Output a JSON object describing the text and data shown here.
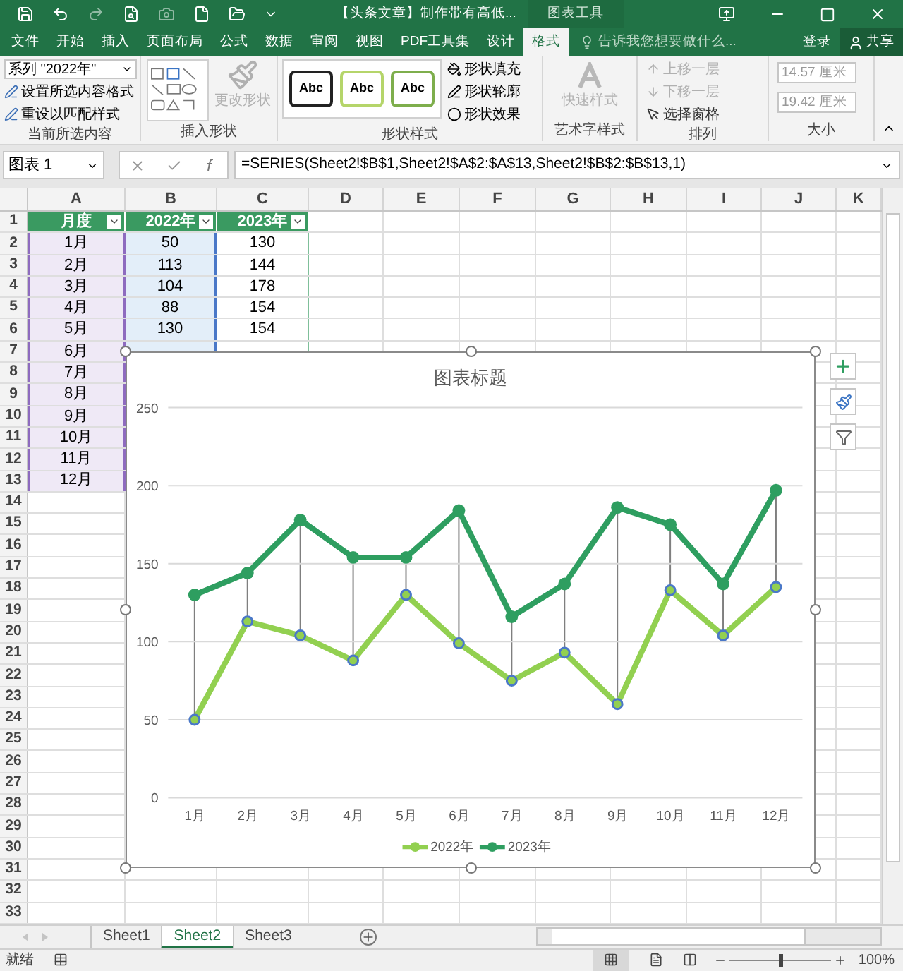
{
  "window": {
    "title": "【头条文章】制作带有高低...",
    "context_tab": "图表工具"
  },
  "ribbon_tabs": [
    {
      "label": "文件",
      "selected": false
    },
    {
      "label": "开始",
      "selected": false
    },
    {
      "label": "插入",
      "selected": false
    },
    {
      "label": "页面布局",
      "selected": false
    },
    {
      "label": "公式",
      "selected": false
    },
    {
      "label": "数据",
      "selected": false
    },
    {
      "label": "审阅",
      "selected": false
    },
    {
      "label": "视图",
      "selected": false
    },
    {
      "label": "PDF工具集",
      "selected": false
    },
    {
      "label": "设计",
      "selected": false
    },
    {
      "label": "格式",
      "selected": true
    }
  ],
  "tell_me": {
    "placeholder": "告诉我您想要做什么..."
  },
  "sign_in": "登录",
  "share": "共享",
  "ribbon": {
    "groups": [
      {
        "kind": "selection",
        "label": "当前所选内容",
        "dropdown": "系列 \"2022年\"",
        "buttons": [
          "设置所选内容格式",
          "重设以匹配样式"
        ]
      },
      {
        "kind": "shapes",
        "label": "插入形状",
        "button": {
          "label": "更改形状",
          "disabled": true
        }
      },
      {
        "kind": "styles",
        "label": "形状样式",
        "samples": [
          "Abc",
          "Abc",
          "Abc"
        ],
        "buttons": [
          "形状填充",
          "形状轮廓",
          "形状效果"
        ]
      },
      {
        "kind": "wordart",
        "label": "艺术字样式",
        "button": {
          "label": "快速样式",
          "disabled": true
        }
      },
      {
        "kind": "arrange",
        "label": "排列",
        "buttons": [
          {
            "label": "上移一层",
            "disabled": true
          },
          {
            "label": "下移一层",
            "disabled": true
          },
          {
            "label": "选择窗格",
            "disabled": false
          }
        ]
      },
      {
        "kind": "size",
        "label": "大小",
        "fields": [
          "14.57 厘米",
          "19.42 厘米"
        ]
      }
    ]
  },
  "name_box": "图表 1",
  "formula": "=SERIES(Sheet2!$B$1,Sheet2!$A$2:$A$13,Sheet2!$B$2:$B$13,1)",
  "columns": [
    "A",
    "B",
    "C",
    "D",
    "E",
    "F",
    "G",
    "H",
    "I",
    "J",
    "K"
  ],
  "rows": [
    "1",
    "2",
    "3",
    "4",
    "5",
    "6",
    "7",
    "8",
    "9",
    "10",
    "11",
    "12",
    "13",
    "14",
    "15",
    "16",
    "17",
    "18",
    "19",
    "20",
    "21",
    "22",
    "23",
    "24",
    "25",
    "26",
    "27",
    "28",
    "29",
    "30",
    "31",
    "32",
    "33"
  ],
  "table": {
    "headers": [
      {
        "label": "月度",
        "color": "#8e6bbf"
      },
      {
        "label": "2022年",
        "color": "#4a78c8"
      },
      {
        "label": "2023年"
      }
    ],
    "rows": [
      [
        "1月",
        "50",
        "130"
      ],
      [
        "2月",
        "113",
        "144"
      ],
      [
        "3月",
        "104",
        "178"
      ],
      [
        "4月",
        "88",
        "154"
      ],
      [
        "5月",
        "130",
        "154"
      ],
      [
        "6月"
      ],
      [
        "7月"
      ],
      [
        "8月"
      ],
      [
        "9月"
      ],
      [
        "10月"
      ],
      [
        "11月"
      ],
      [
        "12月"
      ]
    ]
  },
  "chart": {
    "selected": true,
    "high_low_lines": true,
    "chart_data": {
      "type": "line",
      "title": "图表标题",
      "grid": true,
      "legend": "bottom",
      "categories": [
        "1月",
        "2月",
        "3月",
        "4月",
        "5月",
        "6月",
        "7月",
        "8月",
        "9月",
        "10月",
        "11月",
        "12月"
      ],
      "series": [
        {
          "name": "2022年",
          "color": "#92d050",
          "marker": "circle",
          "values": [
            50,
            113,
            104,
            88,
            130,
            99,
            75,
            93,
            60,
            133,
            104,
            135
          ]
        },
        {
          "name": "2023年",
          "color": "#2e9e60",
          "marker": "circle",
          "values": [
            130,
            144,
            178,
            154,
            154,
            184,
            116,
            137,
            186,
            175,
            137,
            197
          ]
        }
      ],
      "ylim": [
        0,
        250
      ],
      "yticks": [
        0,
        50,
        100,
        150,
        200,
        250
      ]
    }
  },
  "sheets": [
    {
      "label": "Sheet1",
      "selected": false
    },
    {
      "label": "Sheet2",
      "selected": true
    },
    {
      "label": "Sheet3",
      "selected": false
    }
  ],
  "status": {
    "text": "就绪",
    "zoom": "100%",
    "zoom_slider": {
      "level": 0.5
    }
  }
}
